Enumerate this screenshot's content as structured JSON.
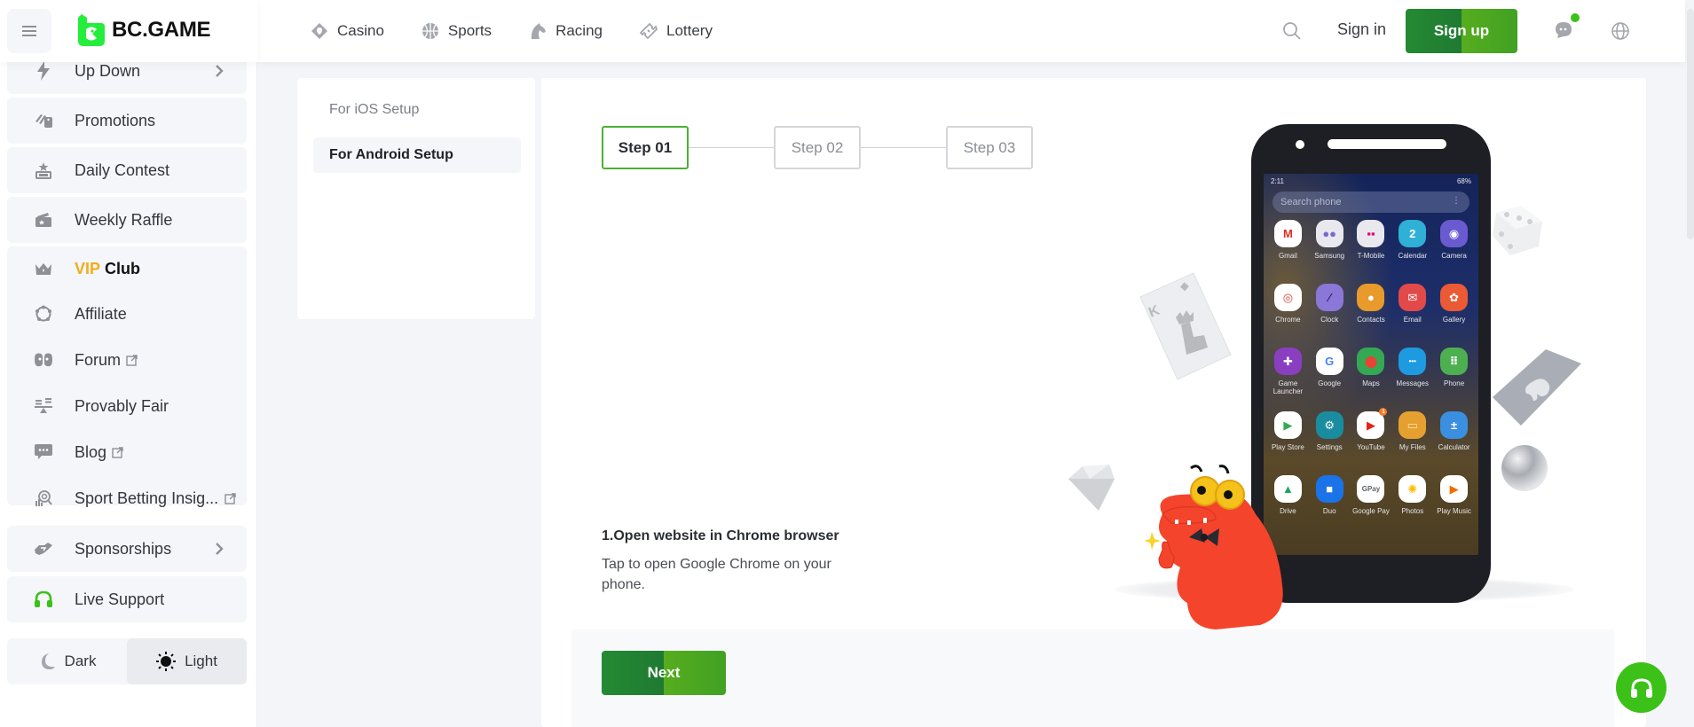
{
  "brand": {
    "name": "BC.GAME",
    "accent": "#3bc117",
    "vip_color": "#f1ad1d"
  },
  "sidebar": {
    "items": [
      {
        "label": "Up Down",
        "icon": "lightning-icon",
        "has_chevron": true
      },
      {
        "label": "Promotions",
        "icon": "tags-icon"
      },
      {
        "label": "Daily Contest",
        "icon": "trophy-podium-icon"
      },
      {
        "label": "Weekly Raffle",
        "icon": "ticket-icon"
      },
      {
        "label_vip": "VIP",
        "label_club": "Club",
        "icon": "crown-icon"
      },
      {
        "label": "Affiliate",
        "icon": "affiliate-ring-icon"
      },
      {
        "label": "Forum",
        "icon": "forum-icon",
        "external": true
      },
      {
        "label": "Provably Fair",
        "icon": "scale-icon"
      },
      {
        "label": "Blog",
        "icon": "chat-bubble-icon",
        "external": true
      },
      {
        "label": "Sport Betting Insig...",
        "icon": "insight-icon",
        "external": true
      },
      {
        "label": "Sponsorships",
        "icon": "handshake-icon",
        "has_chevron": true
      },
      {
        "label": "Live Support",
        "icon": "headset-icon"
      }
    ],
    "theme": {
      "dark_label": "Dark",
      "light_label": "Light",
      "selected": "Light"
    }
  },
  "header": {
    "nav": [
      {
        "label": "Casino",
        "icon": "casino-cards-icon"
      },
      {
        "label": "Sports",
        "icon": "basketball-icon"
      },
      {
        "label": "Racing",
        "icon": "horse-icon"
      },
      {
        "label": "Lottery",
        "icon": "lottery-ticket-icon"
      }
    ],
    "signin_label": "Sign in",
    "signup_label": "Sign up"
  },
  "setup_tabs": [
    {
      "label": "For iOS Setup",
      "active": false
    },
    {
      "label": "For Android Setup",
      "active": true
    }
  ],
  "steps": [
    {
      "label": "Step 01",
      "active": true
    },
    {
      "label": "Step 02",
      "active": false
    },
    {
      "label": "Step 03",
      "active": false
    }
  ],
  "instruction": {
    "title": "1.Open website in Chrome browser",
    "description": "Tap to open Google Chrome on your phone."
  },
  "next_label": "Next",
  "phone": {
    "time": "2:11",
    "status_right": "68%",
    "search_placeholder": "Search phone",
    "apps": [
      {
        "label": "Gmail",
        "color": "#ffffff",
        "glyph": "M",
        "glyph_color": "#d93025"
      },
      {
        "label": "Samsung",
        "color": "#e8e8ee",
        "glyph": "●●",
        "glyph_color": "#7a6bd0"
      },
      {
        "label": "T-Mobile",
        "color": "#e8e8ee",
        "glyph": "▪▪",
        "glyph_color": "#e20074"
      },
      {
        "label": "Calendar",
        "color": "#2fb0d6",
        "glyph": "2",
        "glyph_color": "#ffffff"
      },
      {
        "label": "Camera",
        "color": "#6a5ad0",
        "glyph": "◉",
        "glyph_color": "#ffffff"
      },
      {
        "label": "Chrome",
        "color": "#ffffff",
        "glyph": "◎",
        "glyph_color": "#db4437"
      },
      {
        "label": "Clock",
        "color": "#8a77d8",
        "glyph": "⁄",
        "glyph_color": "#2a2560"
      },
      {
        "label": "Contacts",
        "color": "#e89a2a",
        "glyph": "●",
        "glyph_color": "#ffffff"
      },
      {
        "label": "Email",
        "color": "#e24a4a",
        "glyph": "✉",
        "glyph_color": "#ffffff"
      },
      {
        "label": "Gallery",
        "color": "#ea5a34",
        "glyph": "✿",
        "glyph_color": "#ffffff"
      },
      {
        "label": "Game Launcher",
        "color": "#8a3fc0",
        "glyph": "✚",
        "glyph_color": "#ffffff"
      },
      {
        "label": "Google",
        "color": "#ffffff",
        "glyph": "G",
        "glyph_color": "#4285f4"
      },
      {
        "label": "Maps",
        "color": "#34a853",
        "glyph": "⬤",
        "glyph_color": "#ea4335"
      },
      {
        "label": "Messages",
        "color": "#1e9be0",
        "glyph": "•••",
        "glyph_color": "#ffffff"
      },
      {
        "label": "Phone",
        "color": "#4caf50",
        "glyph": "⠿",
        "glyph_color": "#ffffff"
      },
      {
        "label": "Play Store",
        "color": "#ffffff",
        "glyph": "▶",
        "glyph_color": "#34a853"
      },
      {
        "label": "Settings",
        "color": "#1a8ca0",
        "glyph": "⚙",
        "glyph_color": "#ffffff"
      },
      {
        "label": "YouTube",
        "color": "#ffffff",
        "glyph": "▶",
        "glyph_color": "#e62117",
        "badge": "1"
      },
      {
        "label": "My Files",
        "color": "#e6a030",
        "glyph": "▭",
        "glyph_color": "#ffe3a8"
      },
      {
        "label": "Calculator",
        "color": "#3a8fe0",
        "glyph": "±",
        "glyph_color": "#ffffff"
      },
      {
        "label": "Drive",
        "color": "#ffffff",
        "glyph": "▲",
        "glyph_color": "#1fa463"
      },
      {
        "label": "Duo",
        "color": "#1a73e8",
        "glyph": "■",
        "glyph_color": "#ffffff"
      },
      {
        "label": "Google Pay",
        "color": "#ffffff",
        "glyph": "GPay",
        "glyph_color": "#5f6368"
      },
      {
        "label": "Photos",
        "color": "#ffffff",
        "glyph": "✺",
        "glyph_color": "#fbbc04"
      },
      {
        "label": "Play Music",
        "color": "#ffffff",
        "glyph": "▶",
        "glyph_color": "#ef6c00"
      }
    ]
  }
}
